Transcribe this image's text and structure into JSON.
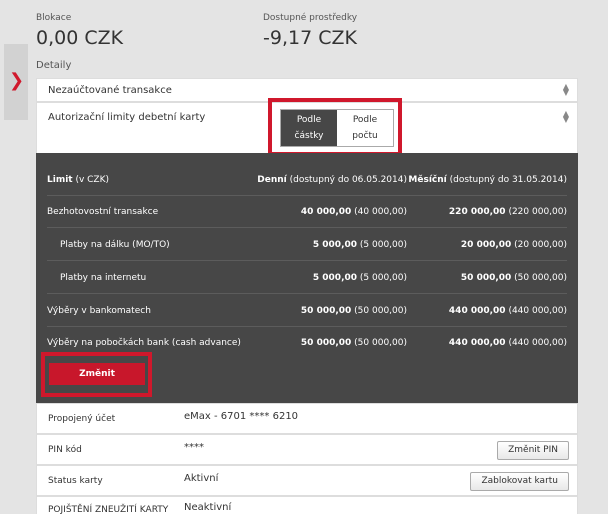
{
  "summary": {
    "blokace_label": "Blokace",
    "blokace_value": "0,00 CZK",
    "dostupne_label": "Dostupné prostředky",
    "dostupne_value": "-9,17 CZK"
  },
  "details_label": "Detaily",
  "rows": {
    "unbilled": "Nezaúčtované transakce",
    "auth_limits": "Autorizační limity debetní karty"
  },
  "toggle": {
    "amount_label": "Podle částky",
    "count_label": "Podle počtu",
    "selected": "amount"
  },
  "limits_table": {
    "header": {
      "col1_bold": "Limit",
      "col1_rest": " (v CZK)",
      "col2_bold": "Denní",
      "col2_rest": " (dostupný do 06.05.2014)",
      "col3_bold": "Měsíční",
      "col3_rest": " (dostupný do 31.05.2014)"
    },
    "rows": [
      {
        "label": "Bezhotovostní transakce",
        "daily": "40 000,00",
        "daily_avail": " (40 000,00)",
        "monthly": "220 000,00",
        "monthly_avail": " (220 000,00)"
      },
      {
        "label": "Platby na dálku (MO/TO)",
        "daily": "5 000,00",
        "daily_avail": " (5 000,00)",
        "monthly": "20 000,00",
        "monthly_avail": " (20 000,00)"
      },
      {
        "label": "Platby na internetu",
        "daily": "5 000,00",
        "daily_avail": " (5 000,00)",
        "monthly": "50 000,00",
        "monthly_avail": " (50 000,00)"
      },
      {
        "label": "Výběry v bankomatech",
        "daily": "50 000,00",
        "daily_avail": " (50 000,00)",
        "monthly": "440 000,00",
        "monthly_avail": " (440 000,00)"
      },
      {
        "label": "Výběry na pobočkách bank (cash advance)",
        "daily": "50 000,00",
        "daily_avail": " (50 000,00)",
        "monthly": "440 000,00",
        "monthly_avail": " (440 000,00)"
      }
    ],
    "change_button": "Změnit"
  },
  "account_info": {
    "linked_label": "Propojený účet",
    "linked_value": "eMax - 6701 **** 6210",
    "pin_label": "PIN kód",
    "pin_value": "****",
    "pin_button": "Změnit PIN",
    "status_label": "Status karty",
    "status_value": "Aktivní",
    "block_button": "Zablokovat kartu",
    "insurance_label": "POJIŠTĚNÍ ZNEUŽITÍ KARTY",
    "insurance_value": "Neaktivní"
  },
  "colors": {
    "accent": "#d0182c",
    "panel": "#474747",
    "background": "#e4e4e4"
  },
  "icons": {
    "side_toggle": "chevron-right-icon",
    "row_expand": "sort-arrows-icon"
  }
}
